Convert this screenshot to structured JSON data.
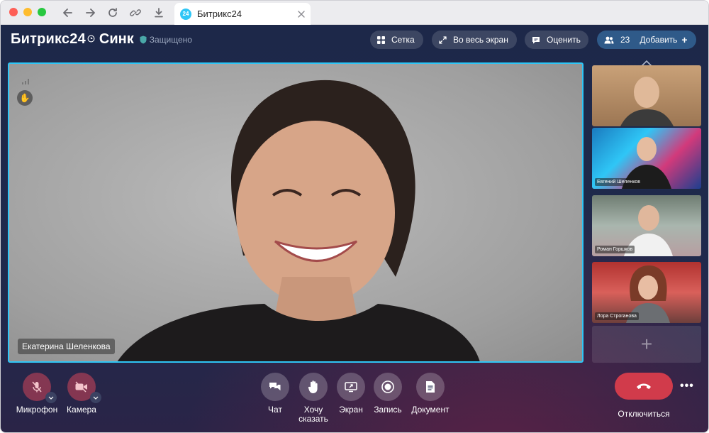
{
  "browser": {
    "tab_title": "Битрикс24",
    "tab_favicon_text": "24",
    "traffic_lights": {
      "close": "#fe5f57",
      "minimize": "#febc2e",
      "maximize": "#28c840"
    }
  },
  "header": {
    "brand": "Битрикс24",
    "product": "Синк",
    "secure_label": "Защищено",
    "buttons": {
      "grid": "Сетка",
      "fullscreen": "Во весь экран",
      "rate": "Оценить",
      "participants_count": "23",
      "add": "Добавить"
    }
  },
  "main_video": {
    "speaker_name": "Екатерина Шеленкова",
    "active_border_color": "#2fc6f6"
  },
  "participants": [
    {
      "name": ""
    },
    {
      "name": "Евгений Шеленков"
    },
    {
      "name": "Роман Горшков"
    },
    {
      "name": "Лора Строганова"
    }
  ],
  "controls": {
    "microphone": "Микрофон",
    "camera": "Камера",
    "chat": "Чат",
    "raise_hand_line1": "Хочу",
    "raise_hand_line2": "сказать",
    "screen": "Экран",
    "record": "Запись",
    "document": "Документ",
    "hangup": "Отключиться",
    "hangup_color": "#d13b4b"
  }
}
